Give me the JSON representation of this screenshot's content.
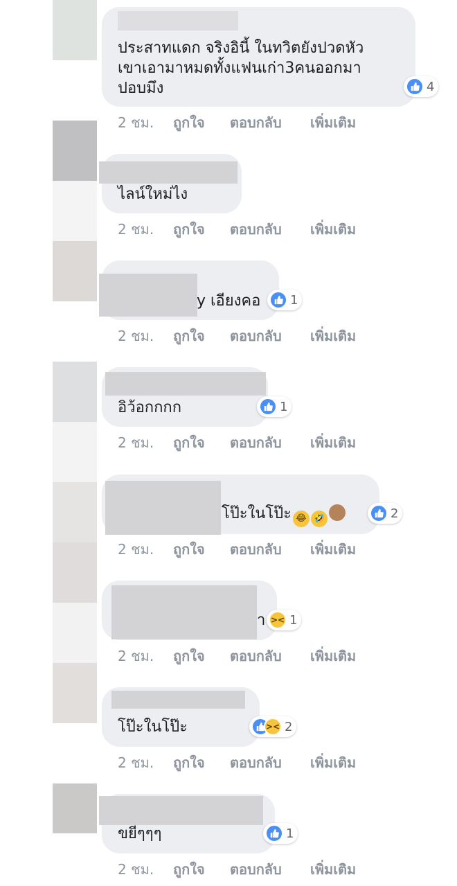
{
  "meta_labels": {
    "time": "2 ชม.",
    "like": "ถูกใจ",
    "reply": "ตอบกลับ",
    "more": "เพิ่มเติม"
  },
  "icons": {
    "like": "like-icon",
    "haha": "haha-reaction-icon",
    "emoji_joy": "tears-of-joy-emoji",
    "emoji_rofl": "rofl-emoji",
    "emoji_monkey": "see-no-evil-monkey-emoji"
  },
  "colors": {
    "like_blue": "#4a8ff5",
    "haha_yellow": "#f7c53c",
    "bubble": "#eceef2",
    "meta_gray": "#8d949e"
  },
  "comments": [
    {
      "text_lines": [
        "ประสาทแดก จริงอินี้ ในทวิตยังปวดหัว",
        "เขาเอามาหมดทั้งแฟนเก่า3คนออกมา",
        "ปอบมึง"
      ],
      "reaction_count": "4"
    },
    {
      "text_lines": [
        "ไลน์ใหม่ไง"
      ],
      "reaction_count": ""
    },
    {
      "text_lines": [
        "y เอียงคอ"
      ],
      "reaction_count": "1"
    },
    {
      "text_lines": [
        "อิว้อกกกก"
      ],
      "reaction_count": "1"
    },
    {
      "text_lines": [
        "โป๊ะในโป๊ะ"
      ],
      "reaction_count": "2"
    },
    {
      "text_lines": [
        "า"
      ],
      "reaction_count": "1"
    },
    {
      "text_lines": [
        "โป๊ะในโป๊ะ"
      ],
      "reaction_count": "2"
    },
    {
      "text_lines": [
        "ขยีๆๆๆ"
      ],
      "reaction_count": "1"
    }
  ]
}
